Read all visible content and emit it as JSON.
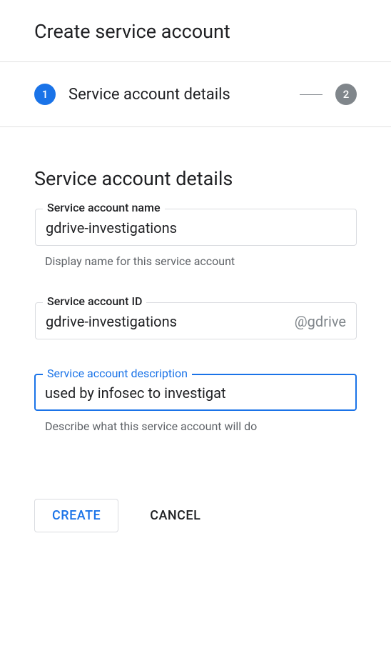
{
  "header": {
    "title": "Create service account"
  },
  "stepper": {
    "steps": [
      {
        "num": "1",
        "label": "Service account details"
      },
      {
        "num": "2",
        "label": ""
      }
    ]
  },
  "section": {
    "title": "Service account details"
  },
  "fields": {
    "name": {
      "label": "Service account name",
      "value": "gdrive-investigations",
      "helper": "Display name for this service account"
    },
    "id": {
      "label": "Service account ID",
      "value": "gdrive-investigations",
      "suffix": "@gdrive"
    },
    "description": {
      "label": "Service account description",
      "value": "used by infosec to investigate gdrive",
      "helper": "Describe what this service account will do"
    }
  },
  "actions": {
    "create": "CREATE",
    "cancel": "CANCEL"
  }
}
